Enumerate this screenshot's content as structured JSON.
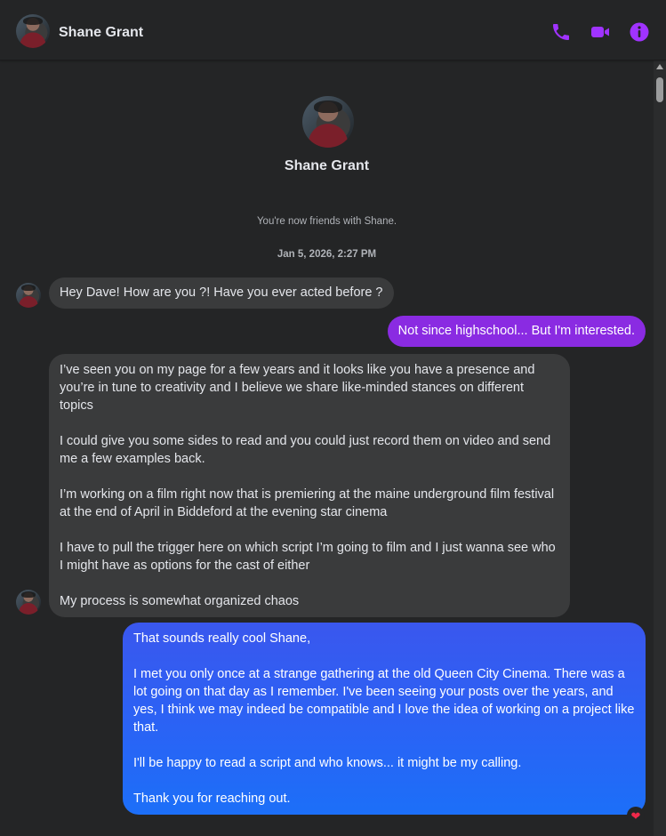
{
  "contact": {
    "name": "Shane Grant"
  },
  "header": {
    "icons": [
      "phone-icon",
      "video-camera-icon",
      "info-icon"
    ],
    "accent_color": "#a033ff"
  },
  "thread": {
    "profile_name": "Shane Grant",
    "system_message": "You're now friends with Shane.",
    "timestamp": "Jan 5, 2026, 2:27 PM",
    "messages": [
      {
        "sender": "Shane Grant",
        "text": "Hey Dave! How are you ?! Have you ever acted before ?"
      },
      {
        "sender": "me",
        "text": "Not since highschool... But I'm interested."
      },
      {
        "sender": "Shane Grant",
        "text": "I’ve seen you on my page for a few years and it looks like you have a presence and you’re in tune to creativity and I believe we share like-minded stances on different topics\n\nI could give you some sides to read and you could just record them on video and send me a few examples back.\n\nI’m working on a film right now that is premiering at the maine underground film festival at the end of April in Biddeford at the evening star cinema\n\nI have to pull the trigger here on which script I’m going to film and I just wanna see who I might have as options for the cast of either\n\nMy process is somewhat organized chaos"
      },
      {
        "sender": "me",
        "text": "That sounds really cool Shane,\n\nI met you only once at a strange gathering at the old Queen City Cinema. There was a lot going on that day as I remember. I've been seeing your posts over the years, and yes, I think we may indeed be compatible and I love the idea of working on a project like that.\n\nI'll be happy to read a script and who knows... it might be my calling.\n\nThank you for reaching out.",
        "reaction": "heart"
      }
    ]
  },
  "colors": {
    "background": "#242526",
    "incoming_bubble": "#3a3b3c",
    "outgoing_bubble_purple": "#8a2be2",
    "outgoing_bubble_blue": "#2a63f5",
    "reaction_heart": "#f0284a"
  }
}
